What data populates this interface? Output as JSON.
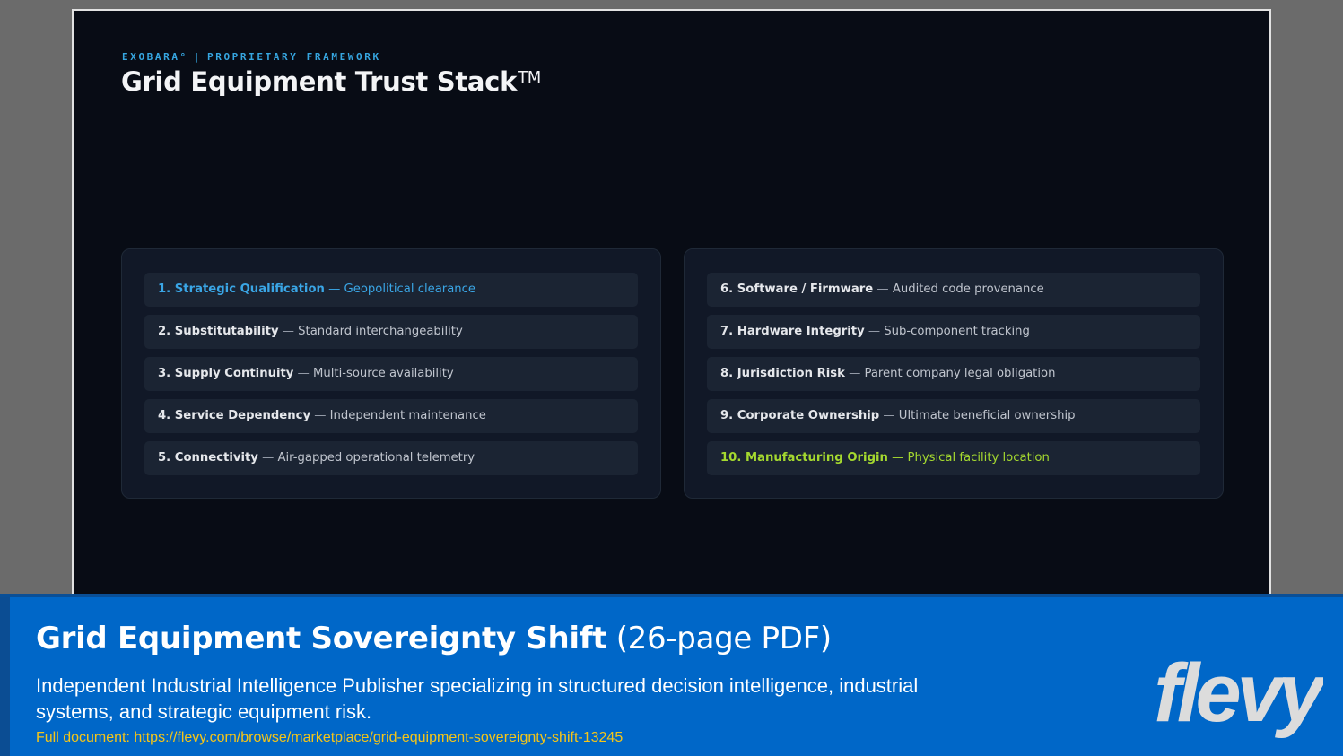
{
  "slide": {
    "eyebrow_brand": "EXOBARA°",
    "eyebrow_sep": "|",
    "eyebrow_label": "PROPRIETARY FRAMEWORK",
    "title": "Grid Equipment Trust Stack",
    "title_mark": "TM",
    "left_items": [
      {
        "name": "1. Strategic Qualification",
        "dash": "—",
        "desc": "Geopolitical clearance",
        "highlight": "blue"
      },
      {
        "name": "2. Substitutability",
        "dash": "—",
        "desc": "Standard interchangeability",
        "highlight": "none"
      },
      {
        "name": "3. Supply Continuity",
        "dash": "—",
        "desc": "Multi-source availability",
        "highlight": "none"
      },
      {
        "name": "4. Service Dependency",
        "dash": "—",
        "desc": "Independent maintenance",
        "highlight": "none"
      },
      {
        "name": "5. Connectivity",
        "dash": "—",
        "desc": "Air-gapped operational telemetry",
        "highlight": "none"
      }
    ],
    "right_items": [
      {
        "name": "6. Software / Firmware",
        "dash": "—",
        "desc": "Audited code provenance",
        "highlight": "none"
      },
      {
        "name": "7. Hardware Integrity",
        "dash": "—",
        "desc": "Sub-component tracking",
        "highlight": "none"
      },
      {
        "name": "8. Jurisdiction Risk",
        "dash": "—",
        "desc": "Parent company legal obligation",
        "highlight": "none"
      },
      {
        "name": "9. Corporate Ownership",
        "dash": "—",
        "desc": "Ultimate beneficial ownership",
        "highlight": "none"
      },
      {
        "name": "10. Manufacturing Origin",
        "dash": "—",
        "desc": "Physical facility location",
        "highlight": "green"
      }
    ]
  },
  "banner": {
    "title": "Grid Equipment Sovereignty Shift",
    "title_suffix": "(26-page PDF)",
    "description": "Independent Industrial Intelligence Publisher specializing in structured decision intelligence, industrial systems, and strategic equipment risk.",
    "link_text": "Full document: https://flevy.com/browse/marketplace/grid-equipment-sovereignty-shift-13245",
    "logo_text": "flevy"
  },
  "colors": {
    "slide_bg": "#080c15",
    "accent_blue": "#3aa6e6",
    "accent_green": "#a5d92f",
    "banner_bg": "#0067c8",
    "link_yellow": "#f5c518"
  }
}
